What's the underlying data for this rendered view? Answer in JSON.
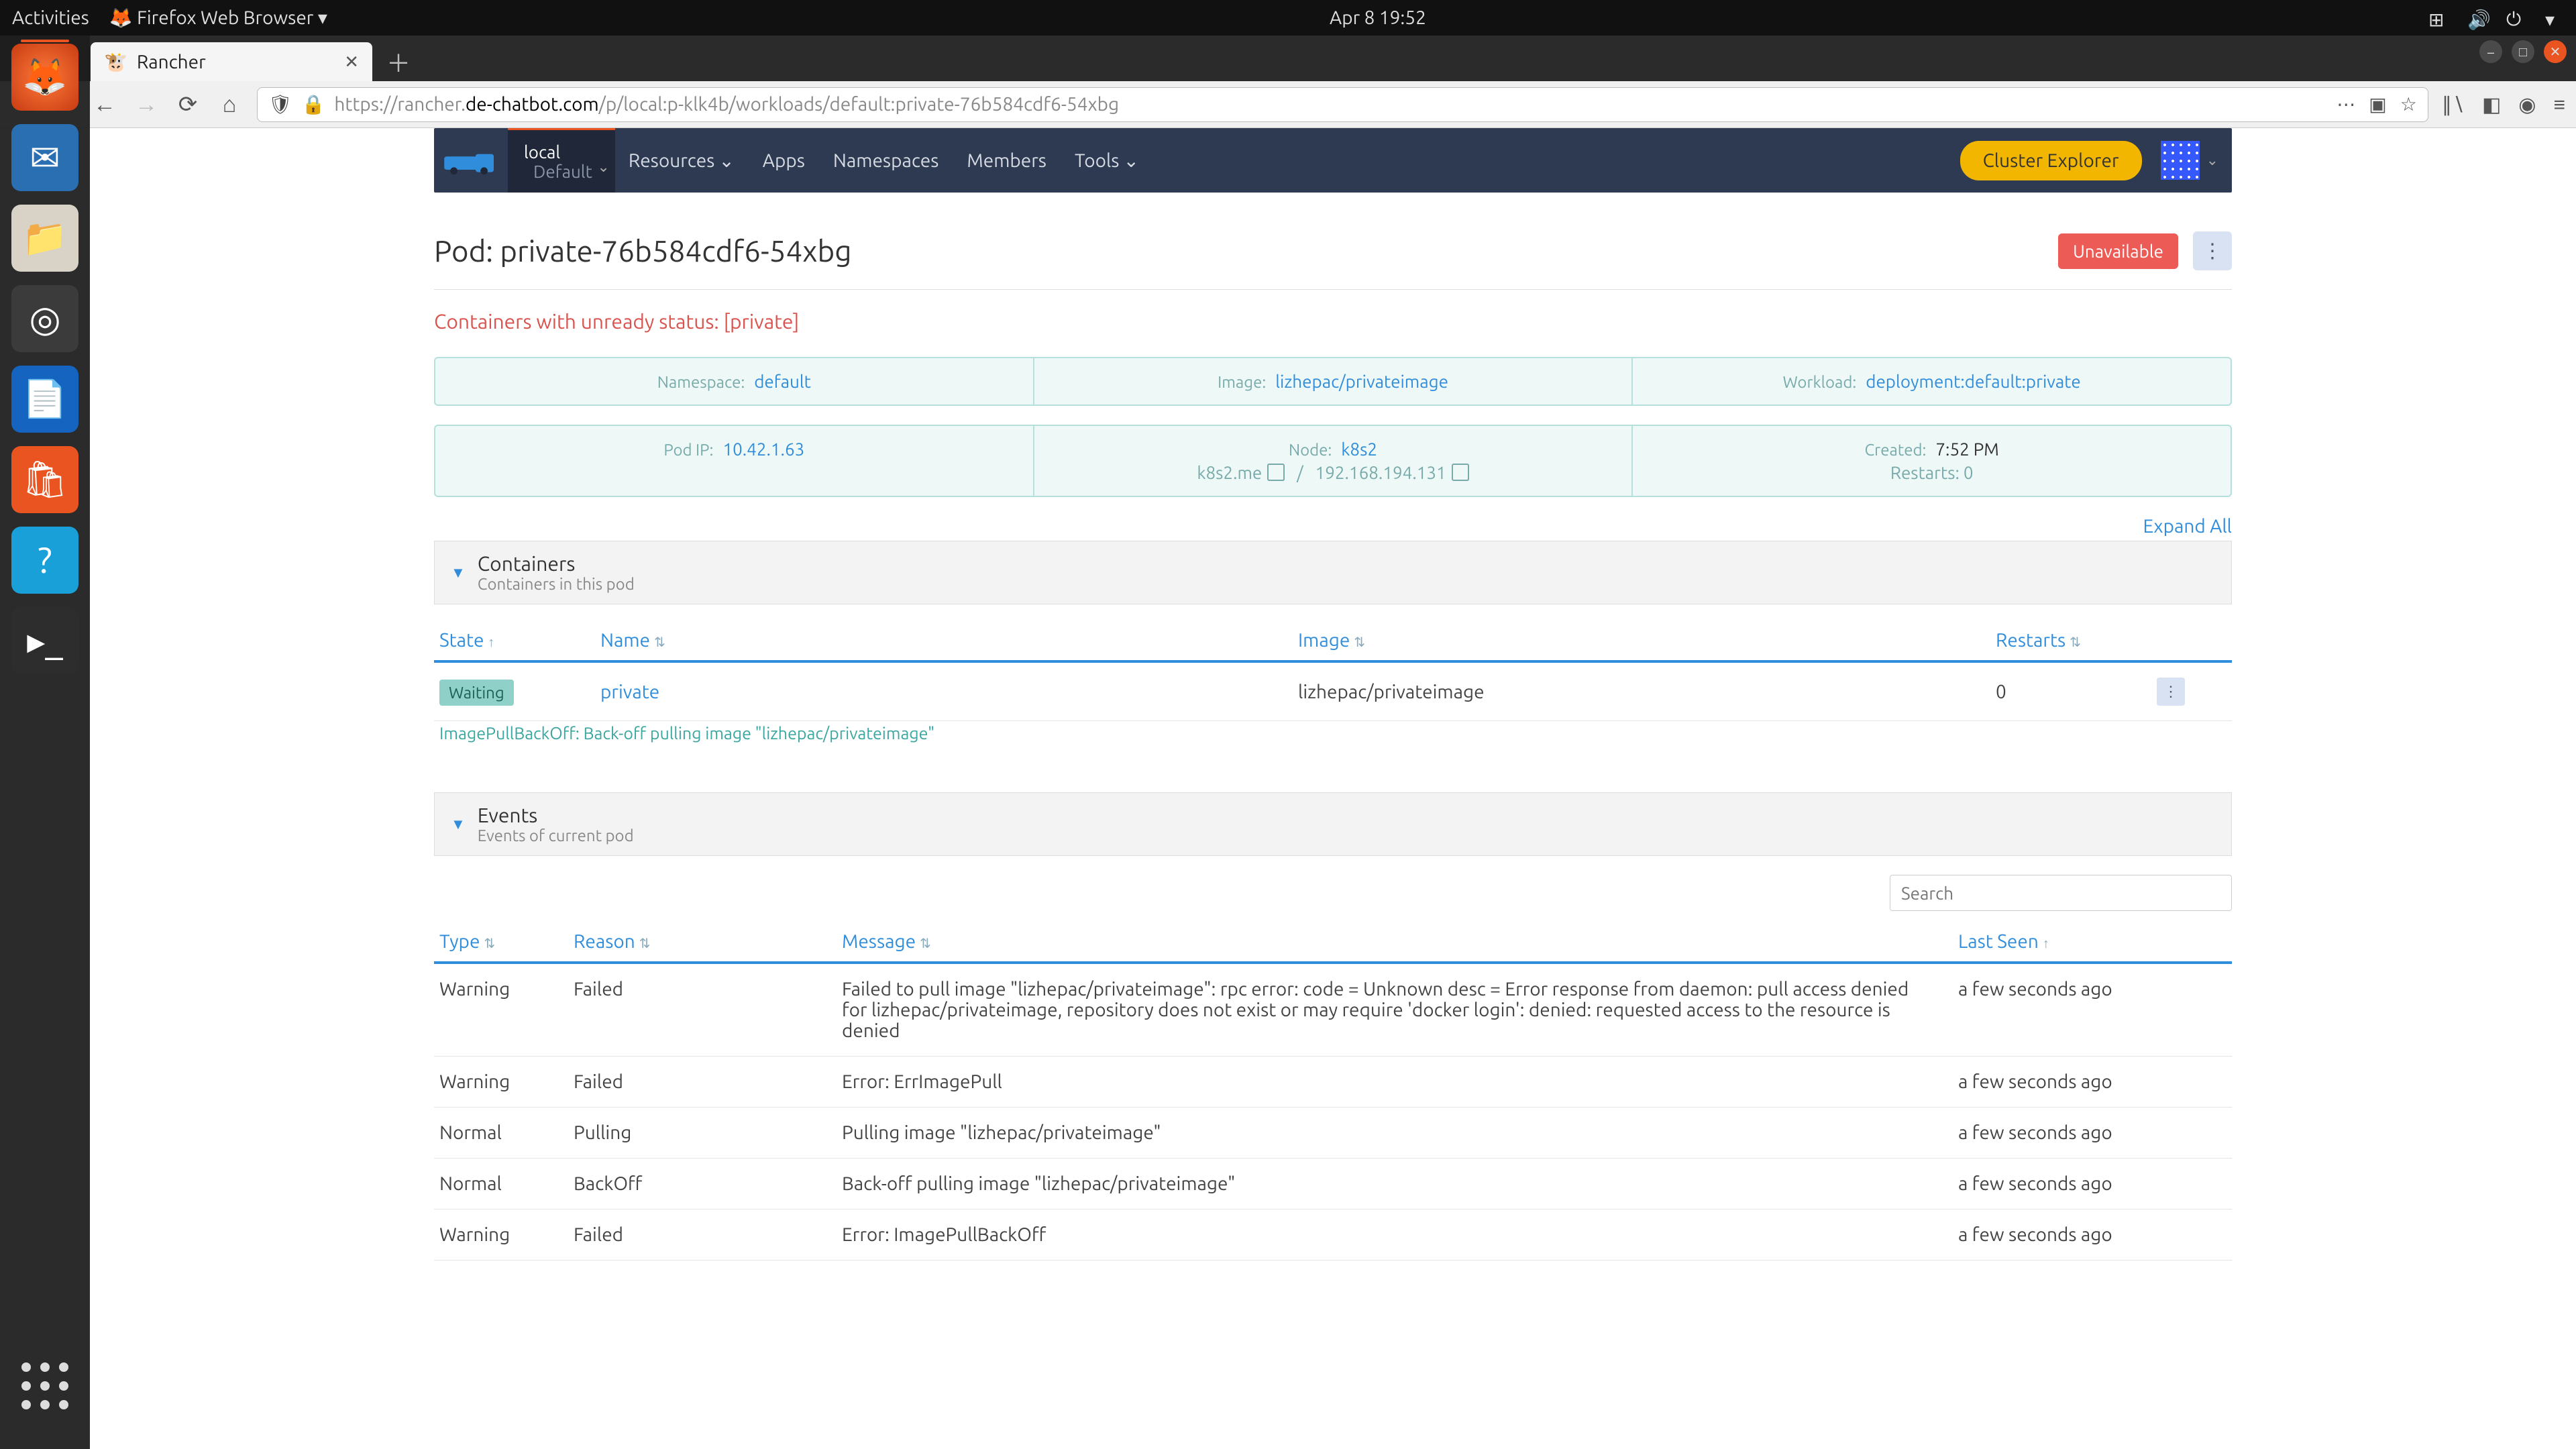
{
  "gnome": {
    "activities": "Activities",
    "app_label": "Firefox Web Browser",
    "clock": "Apr 8  19:52"
  },
  "firefox": {
    "tab_title": "Rancher",
    "url_prefix": "https://rancher.",
    "url_host": "de-chatbot.com",
    "url_path": "/p/local:p-klk4b/workloads/default:private-76b584cdf6-54xbg"
  },
  "rancher_header": {
    "cluster": "local",
    "project": "Default",
    "nav": [
      "Resources",
      "Apps",
      "Namespaces",
      "Members",
      "Tools"
    ],
    "explorer_btn": "Cluster Explorer"
  },
  "page_title": "Pod: private-76b584cdf6-54xbg",
  "status_badge": "Unavailable",
  "error_line": "Containers with unready status: [private]",
  "info1": {
    "namespace_label": "Namespace:",
    "namespace": "default",
    "image_label": "Image:",
    "image": "lizhepac/privateimage",
    "workload_label": "Workload:",
    "workload": "deployment:default:private"
  },
  "info2": {
    "podip_label": "Pod IP:",
    "podip": "10.42.1.63",
    "node_label": "Node:",
    "node": "k8s2",
    "host1": "k8s2.me",
    "host2": "192.168.194.131",
    "created_label": "Created:",
    "created": "7:52 PM",
    "restarts_label": "Restarts:",
    "restarts": "0"
  },
  "expand_all": "Expand All",
  "containers_panel": {
    "title": "Containers",
    "subtitle": "Containers in this pod",
    "cols": {
      "state": "State",
      "name": "Name",
      "image": "Image",
      "restarts": "Restarts"
    },
    "row": {
      "state": "Waiting",
      "name": "private",
      "image": "lizhepac/privateimage",
      "restarts": "0"
    },
    "sub_error": "ImagePullBackOff: Back-off pulling image \"lizhepac/privateimage\""
  },
  "events_panel": {
    "title": "Events",
    "subtitle": "Events of current pod",
    "search_placeholder": "Search",
    "cols": {
      "type": "Type",
      "reason": "Reason",
      "message": "Message",
      "last_seen": "Last Seen"
    },
    "rows": [
      {
        "type": "Warning",
        "reason": "Failed",
        "message": "Failed to pull image \"lizhepac/privateimage\": rpc error: code = Unknown desc = Error response from daemon: pull access denied for lizhepac/privateimage, repository does not exist or may require 'docker login': denied: requested access to the resource is denied",
        "seen": "a few seconds ago"
      },
      {
        "type": "Warning",
        "reason": "Failed",
        "message": "Error: ErrImagePull",
        "seen": "a few seconds ago"
      },
      {
        "type": "Normal",
        "reason": "Pulling",
        "message": "Pulling image \"lizhepac/privateimage\"",
        "seen": "a few seconds ago"
      },
      {
        "type": "Normal",
        "reason": "BackOff",
        "message": "Back-off pulling image \"lizhepac/privateimage\"",
        "seen": "a few seconds ago"
      },
      {
        "type": "Warning",
        "reason": "Failed",
        "message": "Error: ImagePullBackOff",
        "seen": "a few seconds ago"
      }
    ]
  }
}
